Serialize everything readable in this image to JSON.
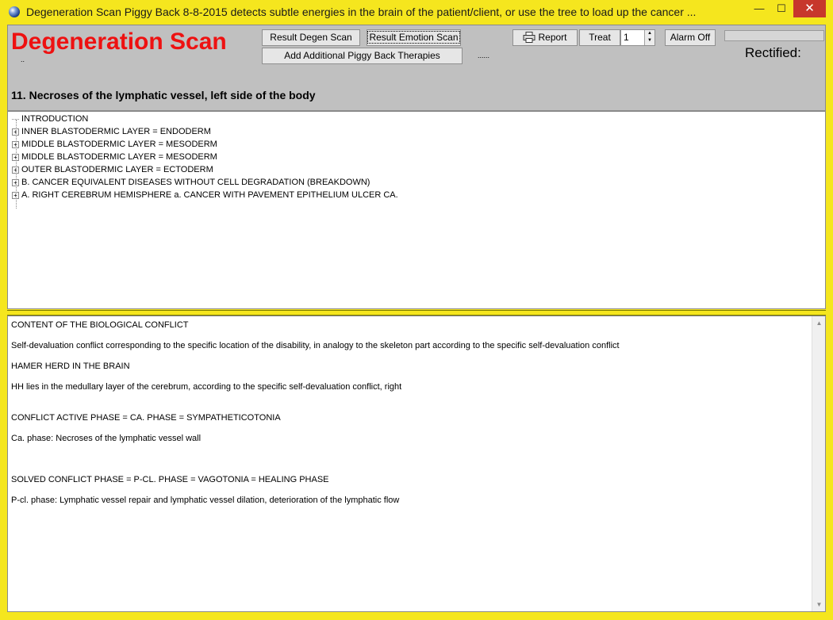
{
  "window": {
    "title": "Degeneration Scan Piggy Back  8-8-2015  detects subtle energies in the brain of the patient/client, or use the tree to load up the cancer ...",
    "min_glyph": "—",
    "max_glyph": "☐",
    "close_glyph": "✕"
  },
  "header": {
    "app_title": "Degeneration Scan",
    "dots_left": "..",
    "dots_mid": "......",
    "result_degen_label": "Result Degen Scan",
    "result_emotion_label": "Result Emotion Scan",
    "add_therapies_label": "Add Additional Piggy Back Therapies",
    "report_label": "Report",
    "treat_label": "Treat",
    "treat_value": "1",
    "alarm_label": "Alarm Off",
    "rectified_label": "Rectified:",
    "subtitle": "11. Necroses of the lymphatic vessel, left side of the body"
  },
  "tree": {
    "items": [
      {
        "label": "INTRODUCTION",
        "expandable": false
      },
      {
        "label": "INNER BLASTODERMIC LAYER = ENDODERM",
        "expandable": true
      },
      {
        "label": "MIDDLE BLASTODERMIC LAYER = MESODERM",
        "expandable": true
      },
      {
        "label": "MIDDLE BLASTODERMIC LAYER = MESODERM",
        "expandable": true
      },
      {
        "label": "OUTER BLASTODERMIC LAYER = ECTODERM",
        "expandable": true
      },
      {
        "label": "B. CANCER EQUIVALENT DISEASES WITHOUT CELL DEGRADATION (BREAKDOWN)",
        "expandable": true
      },
      {
        "label": "A. RIGHT CEREBRUM HEMISPHERE a. CANCER WITH PAVEMENT EPITHELIUM ULCER CA.",
        "expandable": true
      }
    ]
  },
  "content": {
    "paragraphs": [
      "CONTENT OF THE BIOLOGICAL CONFLICT",
      "Self-devaluation conflict corresponding to the specific location of the disability, in analogy to the skeleton part according to the specific self-devaluation conflict",
      "HAMER HERD IN THE BRAIN",
      "HH lies in the medullary layer of the cerebrum, according to the specific self-devaluation conflict, right",
      "CONFLICT ACTIVE PHASE = CA. PHASE = SYMPATHETICOTONIA",
      "Ca. phase: Necroses of the lymphatic vessel wall",
      "SOLVED CONFLICT PHASE = P-CL. PHASE = VAGOTONIA = HEALING PHASE",
      "P-cl. phase: Lymphatic vessel repair and lymphatic vessel dilation, deterioration of the lymphatic flow"
    ]
  },
  "colors": {
    "accent": "#f5e61e",
    "title_red": "#ee1111",
    "panel_gray": "#c0c0c0"
  }
}
